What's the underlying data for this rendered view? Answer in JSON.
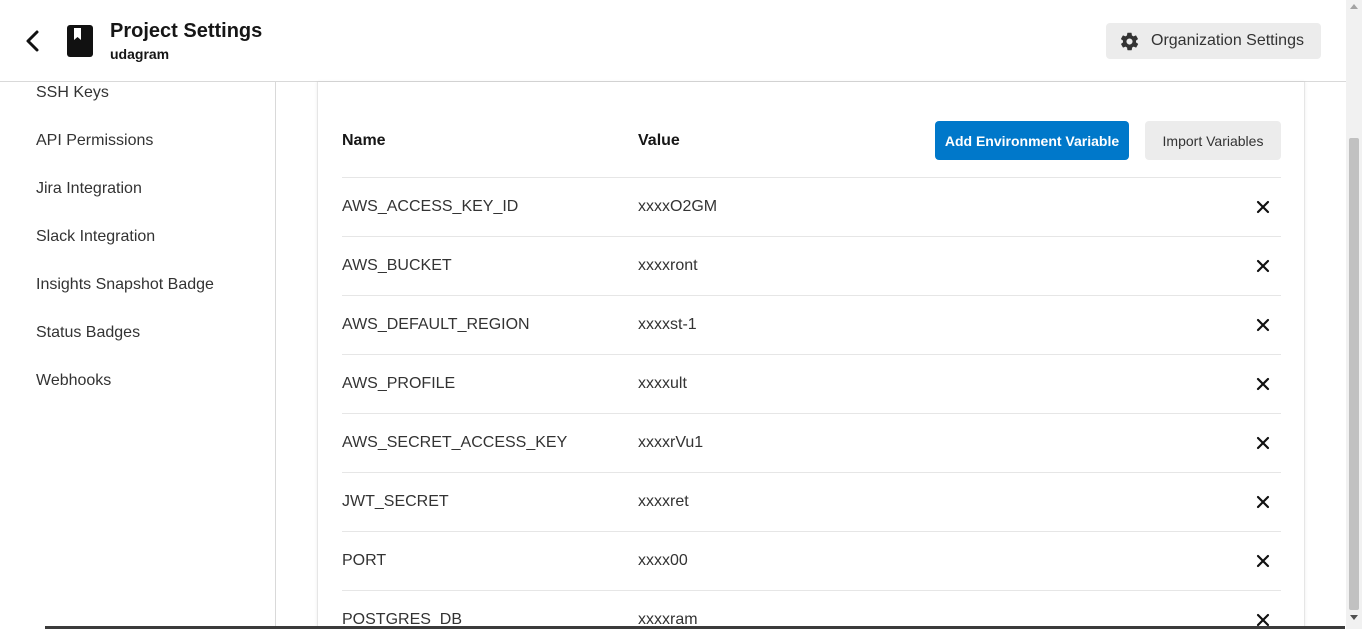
{
  "header": {
    "title": "Project Settings",
    "subtitle": "udagram",
    "org_settings_label": "Organization Settings"
  },
  "sidebar": {
    "items": [
      {
        "label": "SSH Keys"
      },
      {
        "label": "API Permissions"
      },
      {
        "label": "Jira Integration"
      },
      {
        "label": "Slack Integration"
      },
      {
        "label": "Insights Snapshot Badge"
      },
      {
        "label": "Status Badges"
      },
      {
        "label": "Webhooks"
      }
    ]
  },
  "env": {
    "col_name": "Name",
    "col_value": "Value",
    "add_label": "Add Environment Variable",
    "import_label": "Import Variables",
    "rows": [
      {
        "name": "AWS_ACCESS_KEY_ID",
        "value": "xxxxO2GM"
      },
      {
        "name": "AWS_BUCKET",
        "value": "xxxxront"
      },
      {
        "name": "AWS_DEFAULT_REGION",
        "value": "xxxxst-1"
      },
      {
        "name": "AWS_PROFILE",
        "value": "xxxxult"
      },
      {
        "name": "AWS_SECRET_ACCESS_KEY",
        "value": "xxxxrVu1"
      },
      {
        "name": "JWT_SECRET",
        "value": "xxxxret"
      },
      {
        "name": "PORT",
        "value": "xxxx00"
      },
      {
        "name": "POSTGRES_DB",
        "value": "xxxxram"
      }
    ]
  },
  "icons": {
    "back": "chevron-left-icon",
    "project": "bookmark-book-icon",
    "gear": "gear-icon",
    "delete": "close-icon"
  },
  "colors": {
    "primary": "#0078ca",
    "secondary_button": "#ececec",
    "border": "#d9d9d9"
  }
}
